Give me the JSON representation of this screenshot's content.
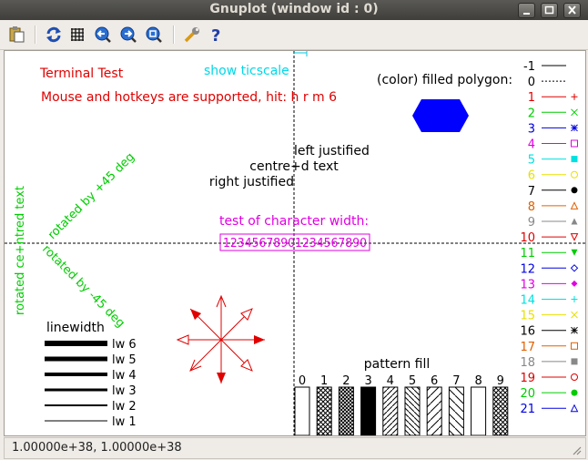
{
  "window": {
    "title": "Gnuplot (window id : 0)"
  },
  "toolbar": {
    "buttons": [
      {
        "name": "copy-clipboard-icon"
      },
      {
        "name": "replot-icon"
      },
      {
        "name": "grid-icon"
      },
      {
        "name": "previous-zoom-icon"
      },
      {
        "name": "next-zoom-icon"
      },
      {
        "name": "autoscale-icon"
      },
      {
        "name": "options-icon"
      },
      {
        "name": "help-icon"
      }
    ]
  },
  "plot": {
    "terminal_title": "Terminal Test",
    "mouse_hint": "Mouse and hotkeys are supported, hit: h r m 6",
    "ticscale_label": "show ticscale",
    "polygon_label": "(color) filled polygon:",
    "left_justified": "left justified",
    "centred_text": "centre+d text",
    "right_justified": "right justified",
    "rot_plus45": "rotated by +45 deg",
    "rot_centred": "rotated ce+ntred text",
    "rot_minus45": "rotated by -45 deg",
    "char_width_label": "test of character width:",
    "char_width_sample": "12345678901234567890",
    "linewidth_title": "linewidth",
    "linewidths": [
      {
        "label": "lw 6",
        "w": 6
      },
      {
        "label": "lw 5",
        "w": 5
      },
      {
        "label": "lw 4",
        "w": 4
      },
      {
        "label": "lw 3",
        "w": 3
      },
      {
        "label": "lw 2",
        "w": 2
      },
      {
        "label": "lw 1",
        "w": 1
      }
    ],
    "pattern_title": "pattern fill",
    "patterns": [
      "0",
      "1",
      "2",
      "3",
      "4",
      "5",
      "6",
      "7",
      "8",
      "9"
    ],
    "linetypes": [
      {
        "label": "-1",
        "color": "#000000"
      },
      {
        "label": "0",
        "color": "#000000"
      },
      {
        "label": "1",
        "color": "#e00000"
      },
      {
        "label": "2",
        "color": "#00cc00"
      },
      {
        "label": "3",
        "color": "#0000e0"
      },
      {
        "label": "4",
        "color": "#e000e0"
      },
      {
        "label": "5",
        "color": "#00e0e0"
      },
      {
        "label": "6",
        "color": "#e8e000"
      },
      {
        "label": "7",
        "color": "#000000"
      },
      {
        "label": "8",
        "color": "#e06000"
      },
      {
        "label": "9",
        "color": "#888888"
      },
      {
        "label": "10",
        "color": "#e00000"
      },
      {
        "label": "11",
        "color": "#00cc00"
      },
      {
        "label": "12",
        "color": "#0000e0"
      },
      {
        "label": "13",
        "color": "#e000e0"
      },
      {
        "label": "14",
        "color": "#00e0e0"
      },
      {
        "label": "15",
        "color": "#e8e000"
      },
      {
        "label": "16",
        "color": "#000000"
      },
      {
        "label": "17",
        "color": "#e06000"
      },
      {
        "label": "18",
        "color": "#888888"
      },
      {
        "label": "19",
        "color": "#e00000"
      },
      {
        "label": "20",
        "color": "#00cc00"
      },
      {
        "label": "21",
        "color": "#0000e0"
      }
    ]
  },
  "status": {
    "coords": "1.00000e+38,  1.00000e+38"
  }
}
